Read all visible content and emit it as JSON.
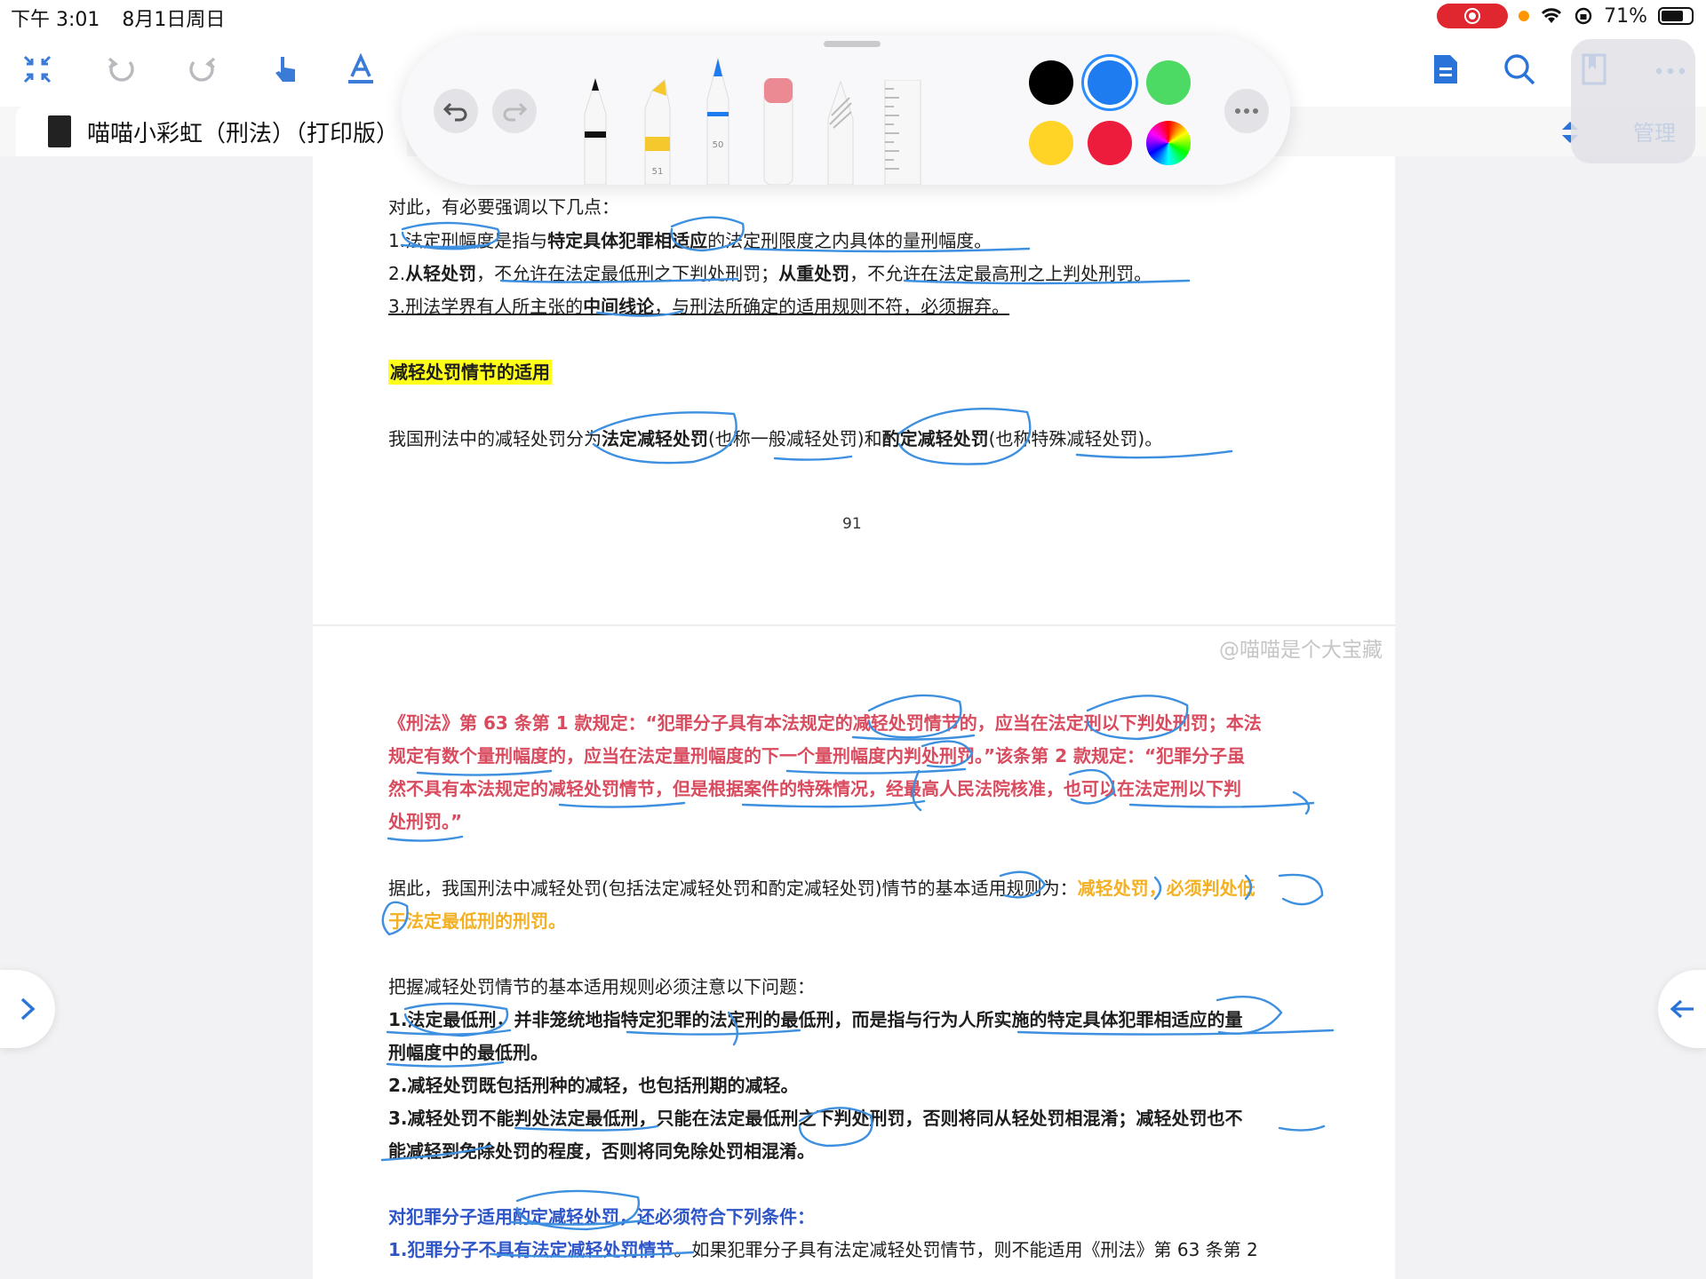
{
  "status_bar": {
    "time": "下午 3:01",
    "date": "8月1日周日",
    "battery_level": 0.71,
    "battery_text": "71%"
  },
  "toolbar": {
    "icons": [
      "collapse-icon",
      "undo-icon",
      "redo-icon",
      "hand-pointer-icon",
      "text-style-icon",
      "document-icon",
      "search-icon",
      "bookmark-icon",
      "more-icon"
    ],
    "active_color": "#1f7cf0"
  },
  "tab": {
    "title": "喵喵小彩虹（刑法）（打印版）"
  },
  "manage_label": "管理",
  "pen_palette": {
    "tools": [
      {
        "name": "pen"
      },
      {
        "name": "highlighter",
        "size_label": "51"
      },
      {
        "name": "pencil",
        "size_label": "50"
      },
      {
        "name": "eraser"
      },
      {
        "name": "lasso"
      },
      {
        "name": "ruler"
      }
    ],
    "colors": [
      "#000000",
      "#1f7cf0",
      "#4cd964",
      "#ffd426",
      "#ee1c3c",
      "rainbow"
    ],
    "selected_color": "#1f7cf0"
  },
  "page1": {
    "intro": "对此，有必要强调以下几点：",
    "p1_a": "1.法定刑幅度是指与",
    "p1_b": "特定具体犯罪相适应",
    "p1_c": "的法定刑限度之内具体的量刑幅度。",
    "p2_a": "2.",
    "p2_b": "从轻处罚",
    "p2_c": "，不允许在法定最低刑之下判处刑罚；",
    "p2_d": "从重处罚",
    "p2_e": "，不允许在法定最高刑之上判处刑罚。",
    "p3_a": "3.刑法学界有人所主张的",
    "p3_b": "中间线论",
    "p3_c": "，与刑法所确定的适用规则不符，必须摒弃。",
    "heading": "减轻处罚情节的适用",
    "s1_a": "我国刑法中的减轻处罚分为",
    "s1_b": "法定减轻处罚",
    "s1_c": "(也称一般减轻处罚)和",
    "s1_d": "酌定减轻处罚",
    "s1_e": "(也称特殊减轻处罚)。",
    "page_number": "91"
  },
  "page2": {
    "watermark": "@喵喵是个大宝藏",
    "law_1": "《刑法》第 63 条第 1 款规定：“犯罪分子具有本法规定的减轻处罚情节的，应当在法定刑以下判处刑罚；本法",
    "law_2": "规定有数个量刑幅度的，应当在法定量刑幅度的下一个量刑幅度内判处刑罚。”该条第 2 款规定：“犯罪分子虽",
    "law_3": "然不具有本法规定的减轻处罚情节，但是根据案件的特殊情况，经最高人民法院核准，也可以在法定刑以下判",
    "law_4": "处刑罚。”",
    "rule_a": "据此，我国刑法中减轻处罚(包括法定减轻处罚和酌定减轻处罚)情节的基本适用规则为：",
    "rule_b": "减轻处罚，必须判处低",
    "rule_c": "于法定最低刑的刑罚。",
    "note_intro": "把握减轻处罚情节的基本适用规则必须注意以下问题：",
    "n1_1": "1.法定最低刑，并非笼统地指特定犯罪的法定刑的最低刑，而是指与行为人所实施的特定具体犯罪相适应的量",
    "n1_2": "刑幅度中的最低刑。",
    "n2": "2.减轻处罚既包括刑种的减轻，也包括刑期的减轻。",
    "n3_1": "3.减轻处罚不能判处法定最低刑，只能在法定最低刑之下判处刑罚，否则将同从轻处罚相混淆；减轻处罚也不",
    "n3_2": "能减轻到免除处罚的程度，否则将同免除处罚相混淆。",
    "cond_heading": "对犯罪分子适用酌定减轻处罚，还必须符合下列条件：",
    "c1_a": "1.犯罪分子不具有法定减轻处罚情节",
    "c1_b": "。如果犯罪分子具有法定减轻处罚情节，则不能适用《刑法》第 63 条第 2"
  }
}
